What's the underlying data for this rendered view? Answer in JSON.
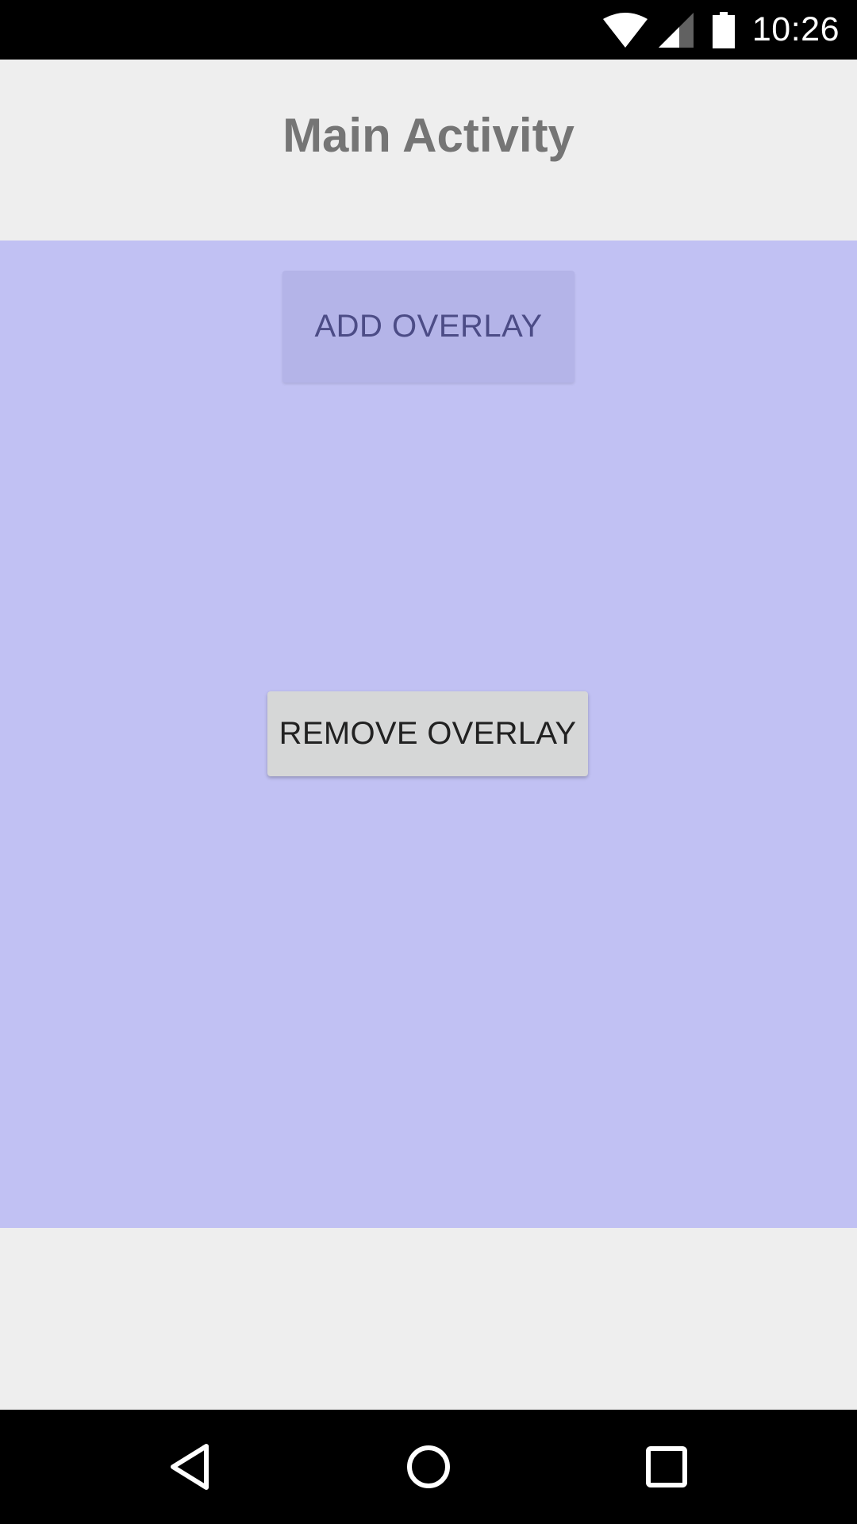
{
  "status_bar": {
    "time": "10:26",
    "icons": [
      "wifi-icon",
      "cell-signal-icon",
      "battery-icon"
    ]
  },
  "header": {
    "title": "Main Activity"
  },
  "overlay": {
    "color": "#c1c1f3",
    "add_button_label": "ADD OVERLAY",
    "remove_button_label": "REMOVE OVERLAY"
  },
  "nav_bar": {
    "icons": [
      "back-icon",
      "home-icon",
      "recents-icon"
    ]
  }
}
